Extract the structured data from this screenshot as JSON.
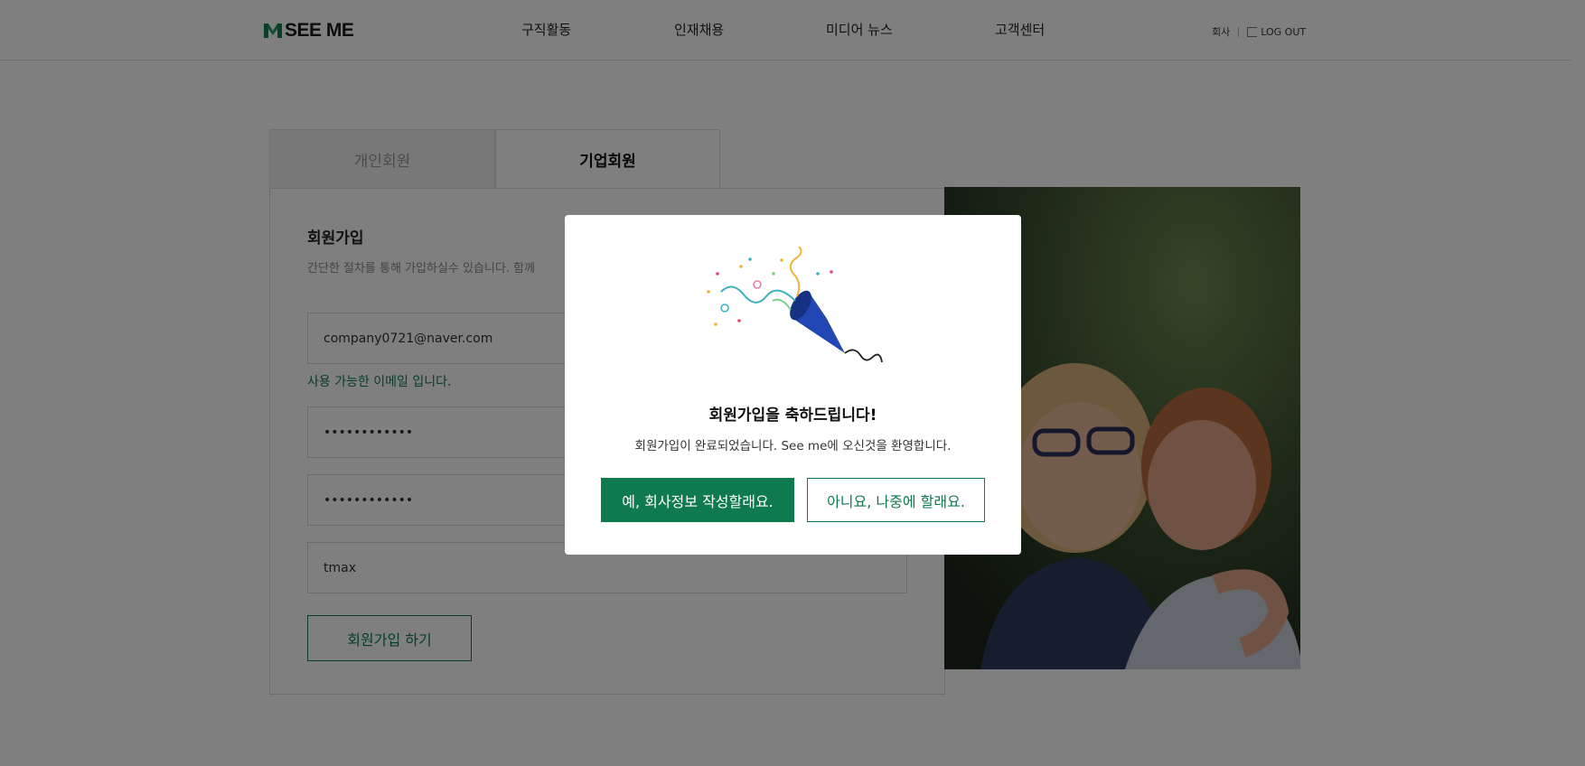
{
  "header": {
    "logo_text": "SEE ME",
    "nav": [
      "구직활동",
      "인재채용",
      "미디어 뉴스",
      "고객센터"
    ],
    "util_company": "회사",
    "util_logout": "LOG OUT"
  },
  "tabs": {
    "personal": "개인회원",
    "company": "기업회원"
  },
  "form": {
    "title": "회원가입",
    "description": "간단한 절차를 통해 가입하실수 있습니다. 함께",
    "email_value": "company0721@naver.com",
    "email_note": "사용 가능한 이메일 입니다.",
    "password_value": "••••••••••••",
    "password_confirm_value": "••••••••••••",
    "name_value": "tmax",
    "submit_label": "회원가입 하기"
  },
  "modal": {
    "title": "회원가입을 축하드립니다!",
    "message": "회원가입이 완료되었습니다. See me에 오신것을 환영합니다.",
    "yes_label": "예, 회사정보 작성할래요.",
    "no_label": "아니요, 나중에 할래요."
  },
  "colors": {
    "brand": "#0e7a4e",
    "overlay": "rgba(0,0,0,0.5)"
  },
  "icons": {
    "logo": "logo-mark-icon",
    "logout": "logout-icon",
    "celebration": "party-popper-icon"
  }
}
